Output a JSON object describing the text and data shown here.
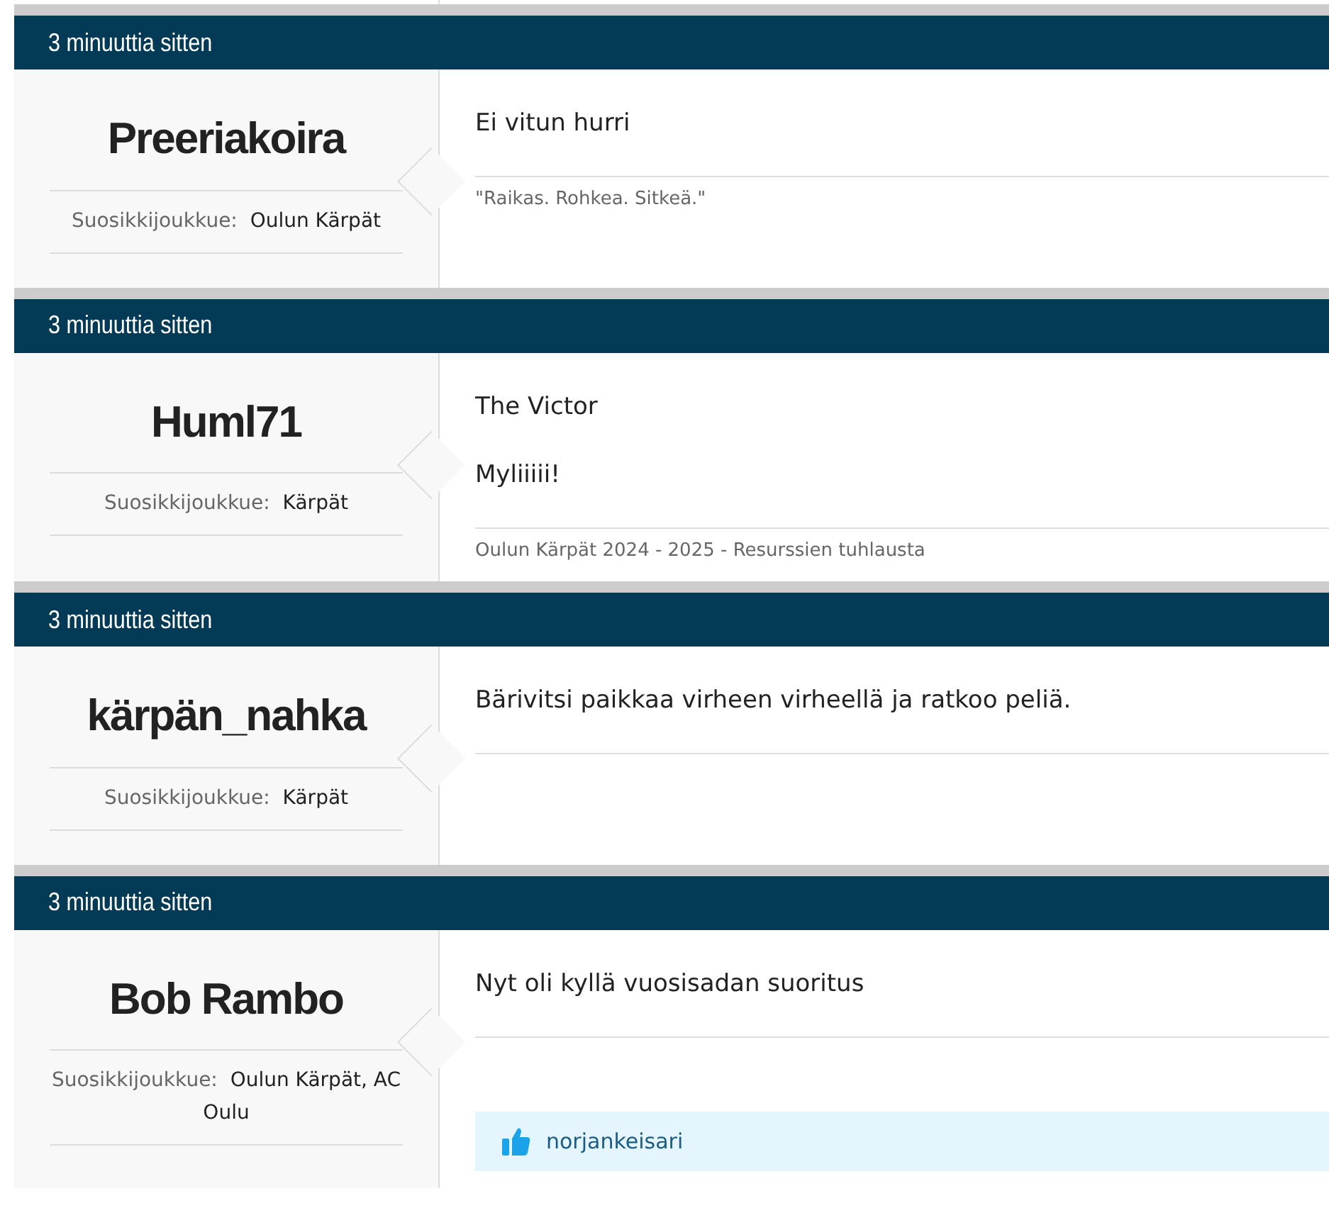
{
  "posts": [
    {
      "time": "3 minuuttia sitten",
      "author": "Preeriakoira",
      "team_label": "Suosikkijoukkue:",
      "team": "Oulun Kärpät",
      "body": [
        "Ei vitun hurri"
      ],
      "signature": "\"Raikas. Rohkea. Sitkeä.\""
    },
    {
      "time": "3 minuuttia sitten",
      "author": "Huml71",
      "team_label": "Suosikkijoukkue:",
      "team": "Kärpät",
      "body": [
        "The Victor",
        "Myliiiii!"
      ],
      "signature": "Oulun Kärpät 2024 - 2025 - Resurssien tuhlausta"
    },
    {
      "time": "3 minuuttia sitten",
      "author": "kärpän_nahka",
      "team_label": "Suosikkijoukkue:",
      "team": "Kärpät",
      "body": [
        "Bärivitsi paikkaa virheen virheellä ja ratkoo peliä."
      ]
    },
    {
      "time": "3 minuuttia sitten",
      "author": "Bob Rambo",
      "team_label": "Suosikkijoukkue:",
      "team": "Oulun Kärpät, AC Oulu",
      "body": [
        "Nyt oli kyllä vuosisadan suoritus"
      ],
      "likes": [
        "norjankeisari"
      ]
    }
  ]
}
